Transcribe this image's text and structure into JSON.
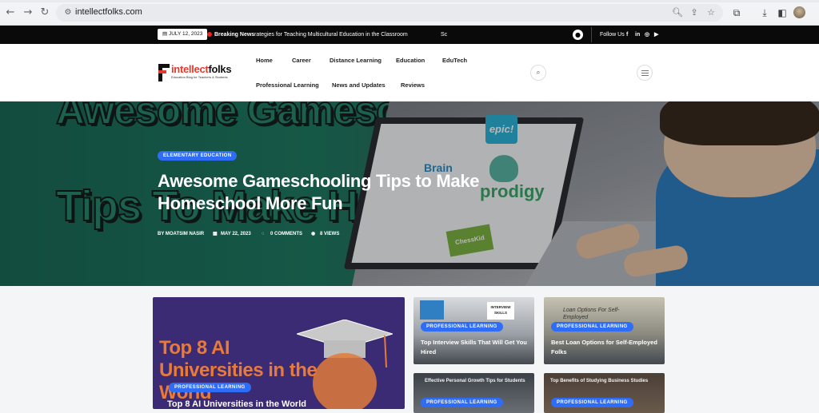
{
  "browser": {
    "url": "intellectfolks.com"
  },
  "topbar": {
    "date": "JULY 12, 2023",
    "breaking_label": "Breaking News",
    "ticker_text": "rategies for Teaching Multicultural Education in the Classroom",
    "ticker_next": "Sc",
    "follow_label": "Follow Us",
    "social": {
      "facebook": "f",
      "linkedin": "in",
      "instagram": "◎",
      "youtube": "▶"
    }
  },
  "logo": {
    "part1": "intellect",
    "part2": "folks",
    "tagline": "Education Blog for Teachers & Students"
  },
  "nav": {
    "items": [
      "Home",
      "Career",
      "Distance Learning",
      "Education",
      "EduTech",
      "Professional Learning",
      "News and Updates",
      "Reviews"
    ]
  },
  "hero": {
    "category": "ELEMENTARY EDUCATION",
    "title_line1": "Awesome Gameschooling Tips to Make",
    "title_line2": "Homeschool More Fun",
    "bg_text_line1": "Awesome Gameschooling",
    "bg_text_line2": "Tips To Make Homeschool",
    "author": "BY MOATSIM NASIR",
    "date": "MAY 22, 2023",
    "comments": "0 COMMENTS",
    "views": "8 VIEWS",
    "logos": {
      "epic": "epic!",
      "brain": "Brain",
      "prodigy": "prodigy",
      "chesskid": "ChessKid"
    }
  },
  "cards": [
    {
      "category": "PROFESSIONAL LEARNING",
      "image_text": "Top 8 AI Universities in the World",
      "title": "Top 8 AI Universities in the World"
    },
    {
      "category": "PROFESSIONAL LEARNING",
      "image_text": "INTERVIEW SKILLS",
      "title": "Top Interview Skills That Will Get You Hired"
    },
    {
      "category": "PROFESSIONAL LEARNING",
      "image_text": "Loan Options For Self-Employed",
      "title": "Best Loan Options for Self-Employed Folks"
    },
    {
      "category": "PROFESSIONAL LEARNING",
      "image_text": "Effective Personal Growth Tips for Students"
    },
    {
      "category": "PROFESSIONAL LEARNING",
      "image_text": "Top Benefits of Studying Business Studies"
    }
  ],
  "colors": {
    "accent": "#2f6df6",
    "brand_red": "#e23b2e",
    "topbar_bg": "#0a0a0a"
  }
}
